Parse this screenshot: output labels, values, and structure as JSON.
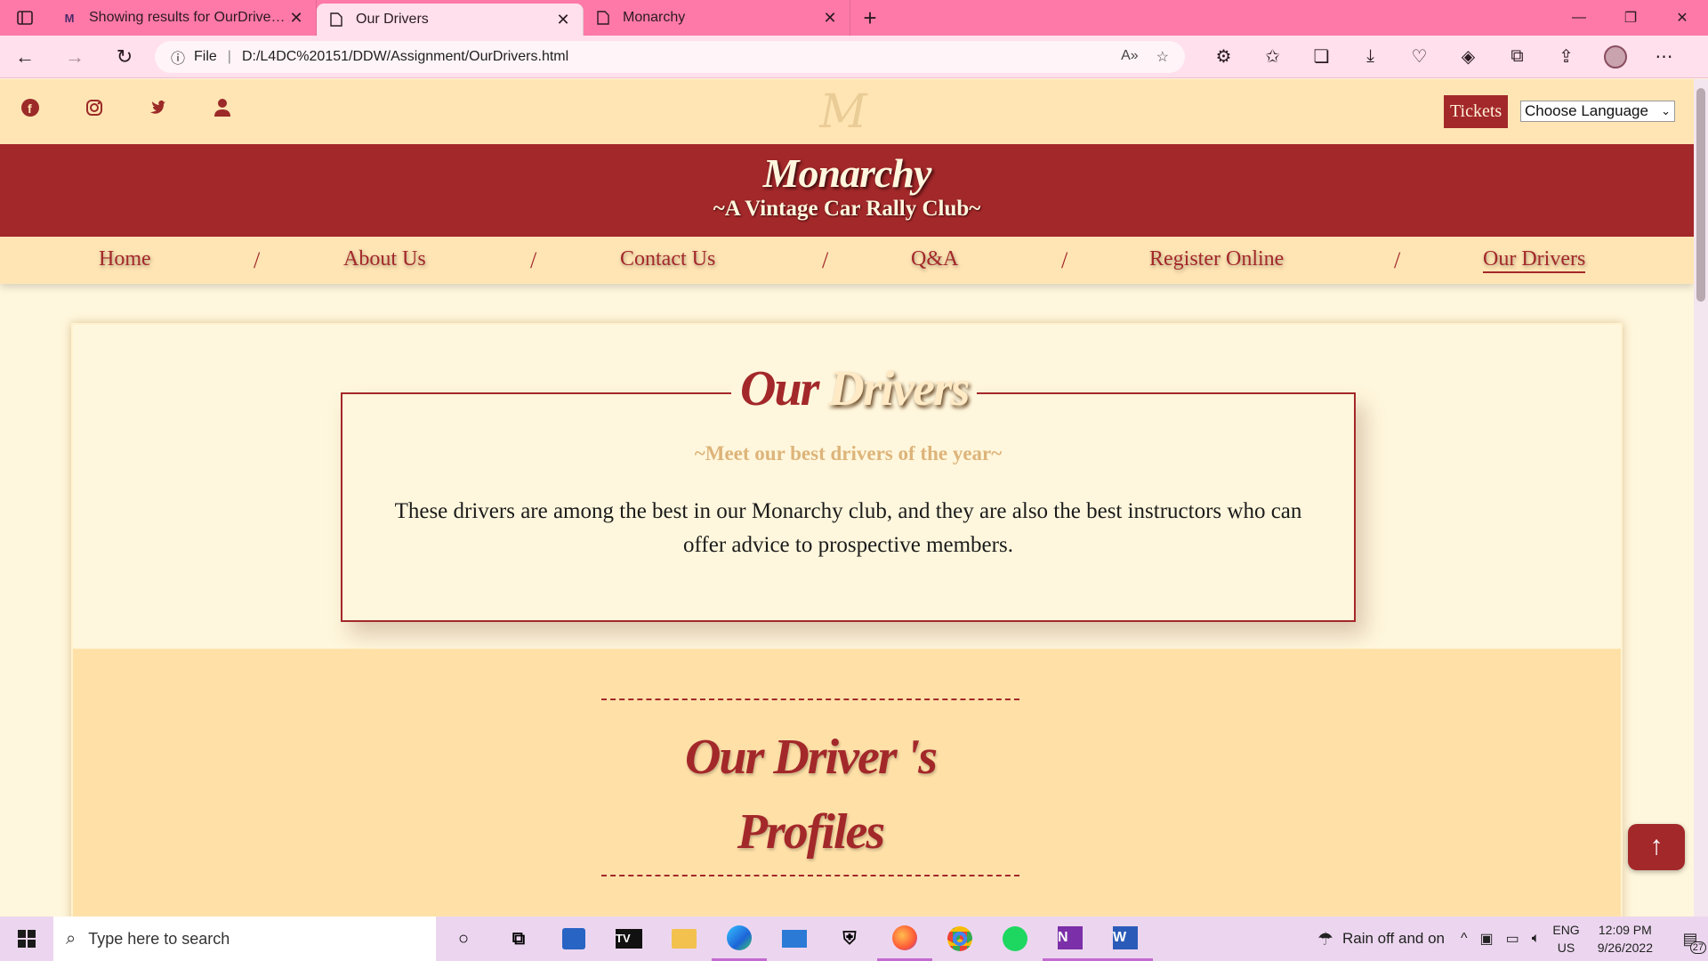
{
  "browser": {
    "tabs": [
      {
        "title": "Showing results for OurDrivers.h",
        "icon": "search-favicon"
      },
      {
        "title": "Our Drivers",
        "icon": "page-icon"
      },
      {
        "title": "Monarchy",
        "icon": "page-icon"
      }
    ],
    "url_prefix": "File",
    "url": "D:/L4DC%20151/DDW/Assignment/OurDrivers.html"
  },
  "site": {
    "tickets_label": "Tickets",
    "language_label": "Choose Language",
    "brand": "Monarchy",
    "tagline": "~A Vintage Car Rally Club~",
    "nav": [
      "Home",
      "About Us",
      "Contact Us",
      "Q&A",
      "Register Online",
      "Our Drivers"
    ],
    "nav_separator": "/",
    "active_nav": "Our Drivers"
  },
  "intro": {
    "title_part1": "Our",
    "title_part2": "Drivers",
    "subtitle": "~Meet our best drivers of the year~",
    "text": "These drivers are among the best in our Monarchy club, and they are also the best instructors who can offer advice to prospective members."
  },
  "profiles": {
    "title_line1": "Our Driver 's",
    "title_line2": "Profiles"
  },
  "taskbar": {
    "search_placeholder": "Type here to search",
    "weather": "Rain off and on",
    "lang_line1": "ENG",
    "lang_line2": "US",
    "time": "12:09 PM",
    "date": "9/26/2022",
    "notifications": "27"
  },
  "colors": {
    "chrome_pink": "#ff79a8",
    "brand_red": "#a3282a",
    "cream": "#fff7dd",
    "peach": "#ffe5b4"
  }
}
